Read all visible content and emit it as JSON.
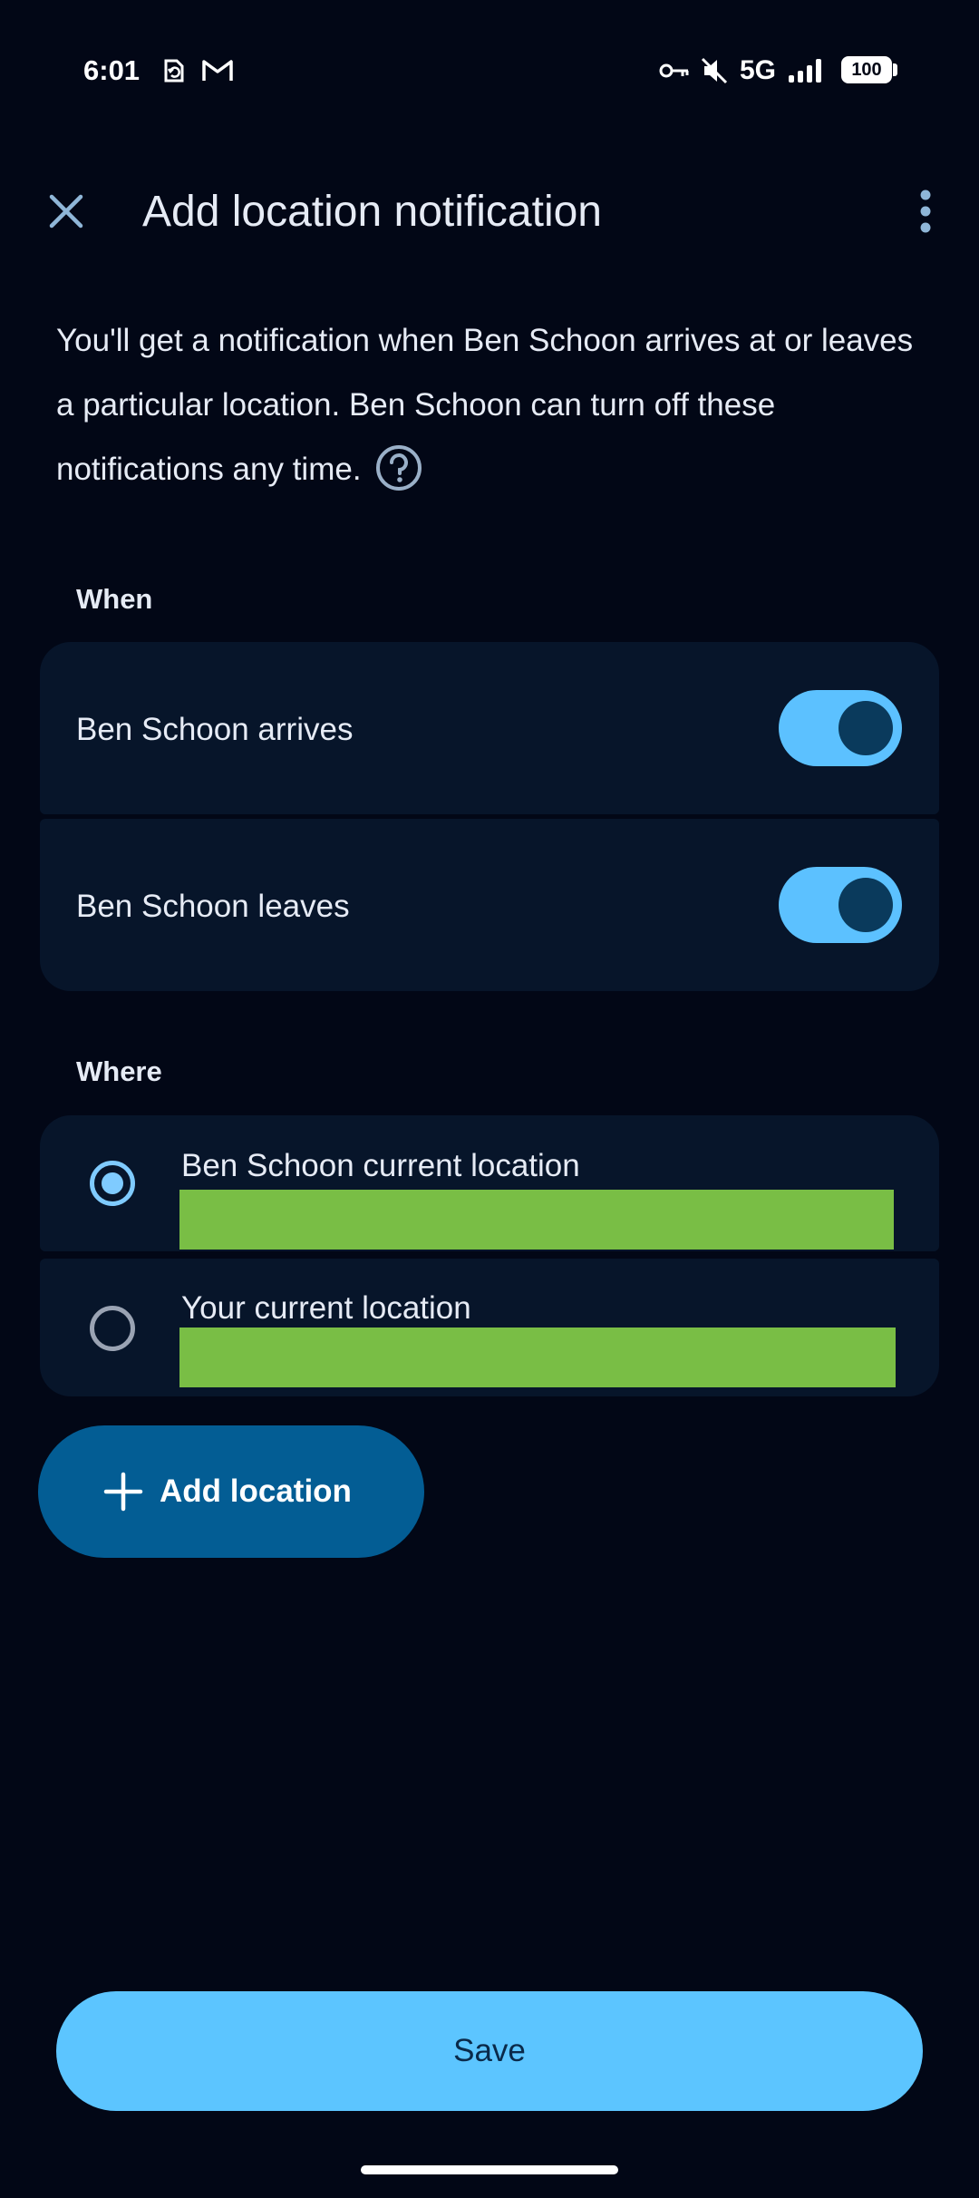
{
  "status_bar": {
    "time": "6:01",
    "network": "5G",
    "battery": "100",
    "icons": [
      "sync-icon",
      "gmail-icon",
      "vpn-key-icon",
      "mute-icon",
      "signal-icon",
      "battery-icon"
    ]
  },
  "app_bar": {
    "title": "Add location notification",
    "close_icon": "close-icon",
    "more_icon": "more-vert-icon"
  },
  "description": "You'll get a notification when Ben Schoon arrives at or leaves a particular location. Ben Schoon can turn off these notifications any time.",
  "when": {
    "label": "When",
    "items": [
      {
        "label": "Ben Schoon arrives",
        "enabled": true
      },
      {
        "label": "Ben Schoon leaves",
        "enabled": true
      }
    ]
  },
  "where": {
    "label": "Where",
    "options": [
      {
        "label": "Ben Schoon current location",
        "selected": true
      },
      {
        "label": "Your current location",
        "selected": false
      }
    ]
  },
  "add_location_label": "Add location",
  "save_label": "Save",
  "colors": {
    "background": "#020716",
    "card": "#07152a",
    "accent": "#5cc1ff",
    "redaction": "#79be45",
    "add_button": "#035d94"
  }
}
